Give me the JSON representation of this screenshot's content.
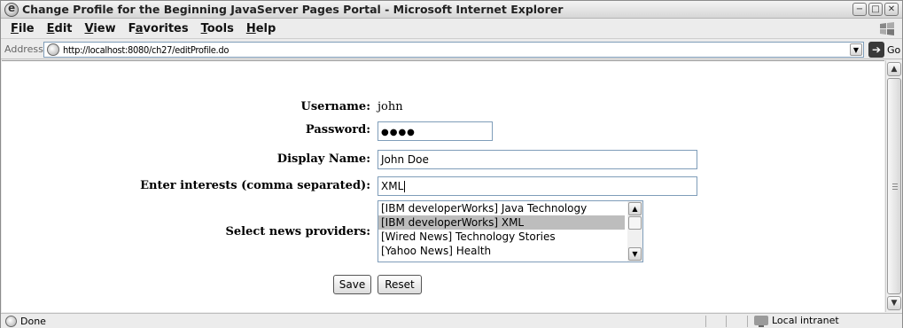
{
  "window": {
    "title": "Change Profile for the Beginning JavaServer Pages Portal - Microsoft Internet Explorer",
    "controls": {
      "minimize": "−",
      "maximize": "□",
      "close": "✕"
    }
  },
  "menu": [
    {
      "underline": "F",
      "rest": "ile"
    },
    {
      "underline": "E",
      "rest": "dit"
    },
    {
      "underline": "V",
      "rest": "iew"
    },
    {
      "underline": "F",
      "rest": "avorites",
      "prefix": "F",
      "mid": "a"
    },
    {
      "underline": "T",
      "rest": "ools"
    },
    {
      "underline": "H",
      "rest": "elp"
    }
  ],
  "menu_labels": [
    "File",
    "Edit",
    "View",
    "Favorites",
    "Tools",
    "Help"
  ],
  "address": {
    "label": "Address",
    "url": "http://localhost:8080/ch27/editProfile.do",
    "go_label": "Go"
  },
  "form": {
    "username_label": "Username:",
    "username_value": "john",
    "password_label": "Password:",
    "password_value": "●●●●",
    "display_name_label": "Display Name:",
    "display_name_value": "John Doe",
    "interests_label": "Enter interests (comma separated):",
    "interests_value": "XML",
    "providers_label": "Select news providers:",
    "providers": [
      {
        "label": "[IBM developerWorks] Java Technology",
        "selected": false
      },
      {
        "label": "[IBM developerWorks] XML",
        "selected": true
      },
      {
        "label": "[Wired News] Technology Stories",
        "selected": false
      },
      {
        "label": "[Yahoo News] Health",
        "selected": false
      }
    ],
    "save_label": "Save",
    "reset_label": "Reset"
  },
  "status": {
    "text": "Done",
    "zone": "Local intranet"
  }
}
